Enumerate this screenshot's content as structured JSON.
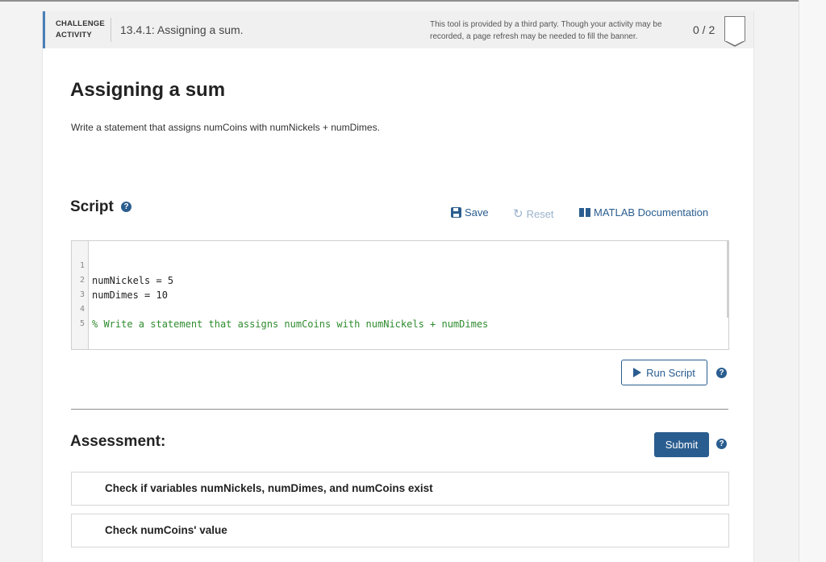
{
  "header": {
    "challenge_line1": "CHALLENGE",
    "challenge_line2": "ACTIVITY",
    "activity_title": "13.4.1: Assigning a sum.",
    "banner_note": "This tool is provided by a third party. Though your activity may be recorded, a page refresh may be needed to fill the banner.",
    "progress": "0 / 2"
  },
  "main": {
    "title": "Assigning a sum",
    "prompt": "Write a statement that assigns numCoins with numNickels + numDimes."
  },
  "script": {
    "heading": "Script",
    "help_glyph": "?",
    "save_label": "Save",
    "reset_label": "Reset",
    "docs_label": "MATLAB Documentation",
    "lines": [
      {
        "num": "1",
        "code": "numNickels = 5",
        "comment": false
      },
      {
        "num": "2",
        "code": "numDimes = 10",
        "comment": false
      },
      {
        "num": "3",
        "code": "",
        "comment": false
      },
      {
        "num": "4",
        "code": "% Write a statement that assigns numCoins with numNickels + numDimes",
        "comment": true
      },
      {
        "num": "5",
        "code": "",
        "comment": false
      }
    ],
    "run_label": "Run Script"
  },
  "assessment": {
    "heading": "Assessment:",
    "submit_label": "Submit",
    "checks": [
      "Check if variables numNickels, numDimes, and numCoins exist",
      "Check numCoins' value"
    ]
  },
  "colors": {
    "accent": "#2a5d8f",
    "header_accent": "#4a7fb8",
    "comment": "#2e8b2e",
    "disabled": "#9ab3cc"
  },
  "icons": [
    "save-icon",
    "reset-icon",
    "book-icon",
    "play-icon",
    "help-icon"
  ]
}
